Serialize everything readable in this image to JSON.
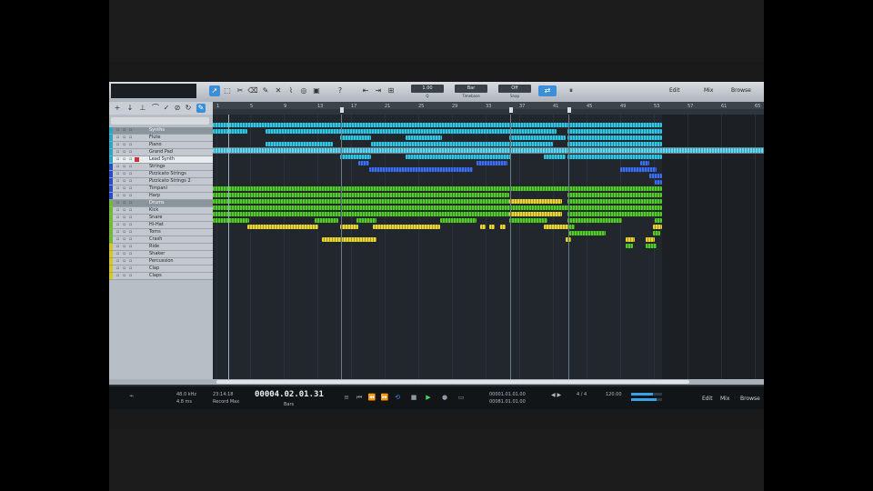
{
  "toolbar": {
    "displays": [
      {
        "value": "1.00",
        "label": "Q"
      },
      {
        "value": "Bar",
        "label": "Timebase"
      },
      {
        "value": "Off",
        "label": "Snap"
      }
    ],
    "right_items": [
      "Edit",
      "Mix",
      "Browse"
    ]
  },
  "ruler": {
    "ticks": [
      "1",
      "5",
      "9",
      "13",
      "17",
      "21",
      "25",
      "29",
      "33",
      "37",
      "41",
      "45",
      "49",
      "53",
      "57",
      "61",
      "65"
    ]
  },
  "tracks": [
    {
      "name": "Synths",
      "color": "#2aa8c8",
      "folder": true
    },
    {
      "name": "Flute",
      "color": "#2aa8c8"
    },
    {
      "name": "Piano",
      "color": "#2aa8c8"
    },
    {
      "name": "Grand Pad",
      "color": "#2aa8c8"
    },
    {
      "name": "Lead Synth",
      "color": "#2aa8c8",
      "selected": true
    },
    {
      "name": "Strings",
      "color": "#2a4cc8"
    },
    {
      "name": "Pizzicato Strings",
      "color": "#2a4cc8"
    },
    {
      "name": "Pizzicato Strings 2",
      "color": "#2a4cc8"
    },
    {
      "name": "Timpani",
      "color": "#2a4cc8"
    },
    {
      "name": "Harp",
      "color": "#2a4cc8"
    },
    {
      "name": "Drums",
      "color": "#6fbd2f",
      "folder": true
    },
    {
      "name": "Kick",
      "color": "#6fbd2f"
    },
    {
      "name": "Snare",
      "color": "#6fbd2f"
    },
    {
      "name": "Hi-Hat",
      "color": "#6fbd2f"
    },
    {
      "name": "Toms",
      "color": "#6fbd2f"
    },
    {
      "name": "Crash",
      "color": "#6fbd2f"
    },
    {
      "name": "Ride",
      "color": "#d6c81e"
    },
    {
      "name": "Shaker",
      "color": "#d6c81e"
    },
    {
      "name": "Percussion",
      "color": "#d6c81e"
    },
    {
      "name": "Clap",
      "color": "#d6c81e"
    },
    {
      "name": "Claps",
      "color": "#d6c81e"
    }
  ],
  "transport": {
    "sample_rate": "48.0 kHz",
    "latency": "4.8 ms",
    "record_time": "23:14:18",
    "record_label": "Record Max",
    "position": "00004.02.01.31",
    "position_unit": "Bars",
    "loop_start": "00001.01.01.00",
    "loop_end": "00081.01.01.00",
    "tempo": "120.00",
    "signature": "4 / 4",
    "right_items": [
      "Edit",
      "Mix",
      "Browse"
    ]
  }
}
